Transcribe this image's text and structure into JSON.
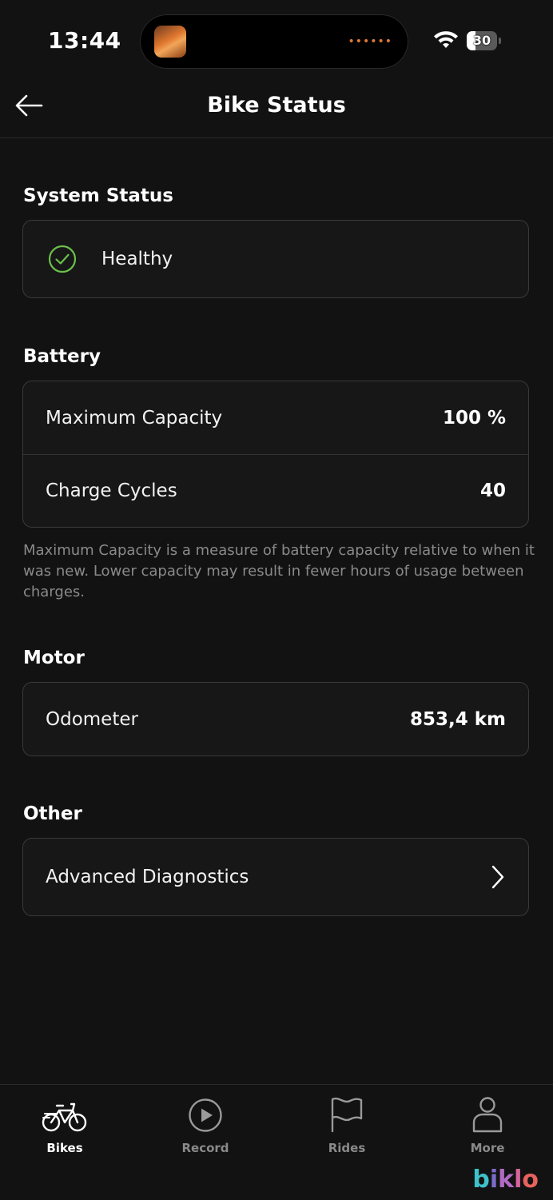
{
  "status_bar": {
    "time": "13:44",
    "battery_level": "30",
    "battery_fraction": 0.3,
    "activity_dots": "••••••"
  },
  "header": {
    "title": "Bike Status",
    "back_icon": "arrow-left-icon"
  },
  "system_status": {
    "title": "System Status",
    "status": "Healthy",
    "status_color": "#6cc04a",
    "status_icon": "check-circle-icon"
  },
  "battery": {
    "title": "Battery",
    "rows": [
      {
        "label": "Maximum Capacity",
        "value": "100 %"
      },
      {
        "label": "Charge Cycles",
        "value": "40"
      }
    ],
    "footnote": "Maximum Capacity is a measure of battery capacity relative to when it was new. Lower capacity may result in fewer hours of usage between charges."
  },
  "motor": {
    "title": "Motor",
    "rows": [
      {
        "label": "Odometer",
        "value": "853,4 km"
      }
    ]
  },
  "other": {
    "title": "Other",
    "rows": [
      {
        "label": "Advanced Diagnostics",
        "icon": "chevron-right-icon"
      }
    ]
  },
  "tabbar": {
    "tabs": [
      {
        "label": "Bikes",
        "icon": "bike-icon",
        "active": true
      },
      {
        "label": "Record",
        "icon": "play-circle-icon",
        "active": false
      },
      {
        "label": "Rides",
        "icon": "flag-icon",
        "active": false
      },
      {
        "label": "More",
        "icon": "person-icon",
        "active": false
      }
    ]
  },
  "watermark": {
    "letters": [
      "b",
      "i",
      "k",
      "l",
      "o"
    ]
  }
}
